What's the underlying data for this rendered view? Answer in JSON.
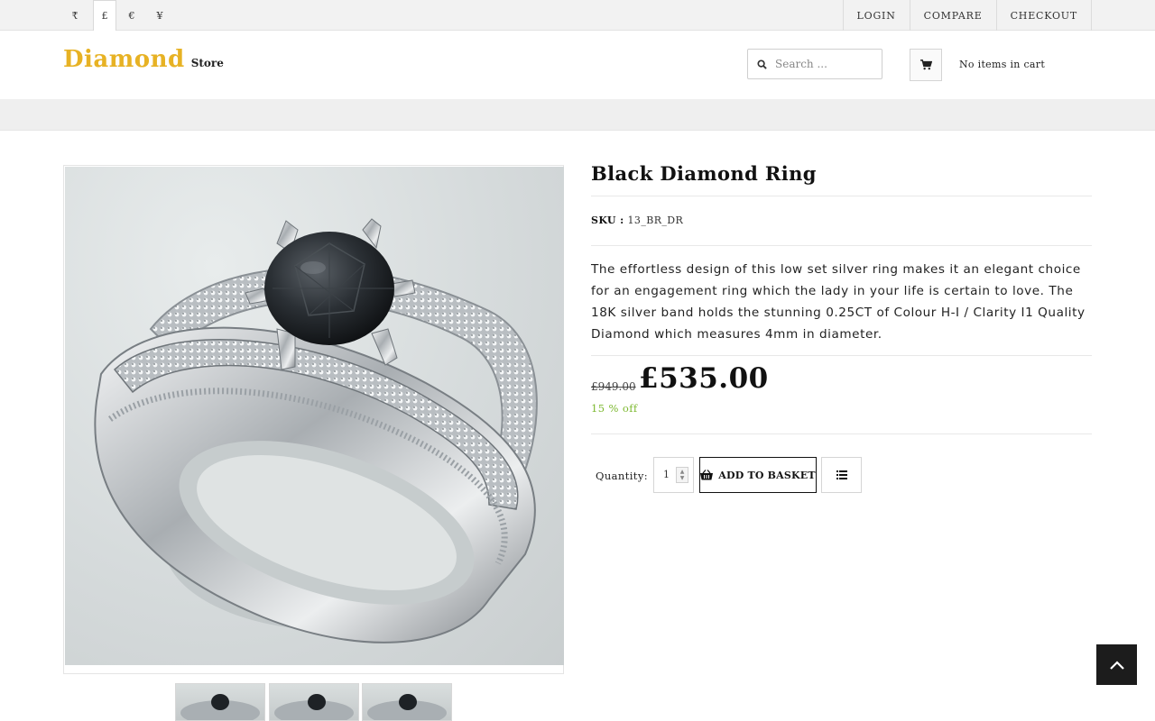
{
  "currencies": [
    {
      "symbol": "₹",
      "active": false
    },
    {
      "symbol": "£",
      "active": true
    },
    {
      "symbol": "€",
      "active": false
    },
    {
      "symbol": "¥",
      "active": false
    }
  ],
  "toplinks": {
    "login": "LOGIN",
    "compare": "COMPARE",
    "checkout": "CHECKOUT"
  },
  "logo": {
    "main": "Diamond",
    "sub": "Store"
  },
  "search": {
    "placeholder": "Search ...",
    "icon": "search-icon"
  },
  "cart": {
    "icon": "shopping-cart-icon",
    "status": "No items in cart"
  },
  "product": {
    "title": "Black Diamond Ring",
    "sku_label": "SKU :",
    "sku": "13_BR_DR",
    "description": "The effortless design of this low set silver ring makes it an elegant choice for an engagement ring which the lady in your life is certain to love. The 18K silver band holds the stunning 0.25CT of Colour H-I / Clarity I1 Quality Diamond which measures 4mm in diameter.",
    "old_price": "£949.00",
    "price": "£535.00",
    "discount": "15 % off",
    "quantity_label": "Quantity:",
    "quantity": "1",
    "add_to_basket": "ADD TO BASKET",
    "image_alt": "Black diamond ring on silver band",
    "thumbnails": 3
  },
  "colors": {
    "brand": "#e7b224",
    "discount": "#7cb82f",
    "dark": "#1c1c1c"
  },
  "icons": {
    "basket": "basket-icon",
    "list": "list-icon",
    "scroll_top": "chevron-up-icon"
  }
}
